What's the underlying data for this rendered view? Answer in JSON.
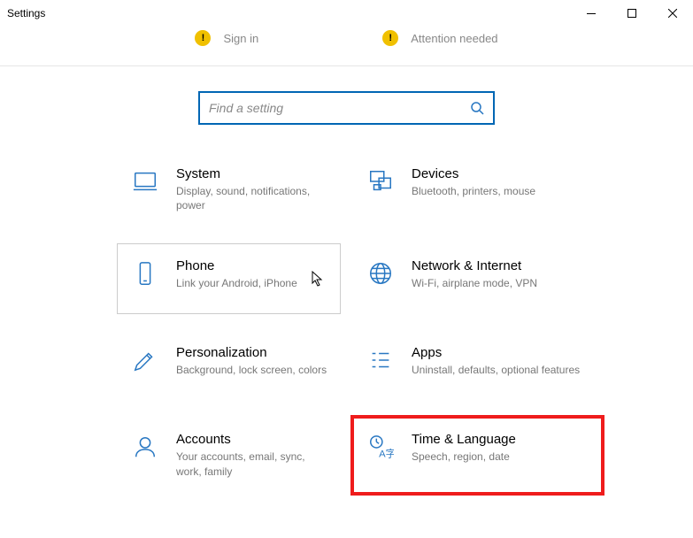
{
  "window": {
    "title": "Settings"
  },
  "alerts": {
    "sign_in": "Sign in",
    "attention": "Attention needed"
  },
  "search": {
    "placeholder": "Find a setting"
  },
  "tiles": {
    "system": {
      "title": "System",
      "desc": "Display, sound, notifications, power"
    },
    "devices": {
      "title": "Devices",
      "desc": "Bluetooth, printers, mouse"
    },
    "phone": {
      "title": "Phone",
      "desc": "Link your Android, iPhone"
    },
    "network": {
      "title": "Network & Internet",
      "desc": "Wi-Fi, airplane mode, VPN"
    },
    "personal": {
      "title": "Personalization",
      "desc": "Background, lock screen, colors"
    },
    "apps": {
      "title": "Apps",
      "desc": "Uninstall, defaults, optional features"
    },
    "accounts": {
      "title": "Accounts",
      "desc": "Your accounts, email, sync, work, family"
    },
    "time": {
      "title": "Time & Language",
      "desc": "Speech, region, date"
    }
  }
}
